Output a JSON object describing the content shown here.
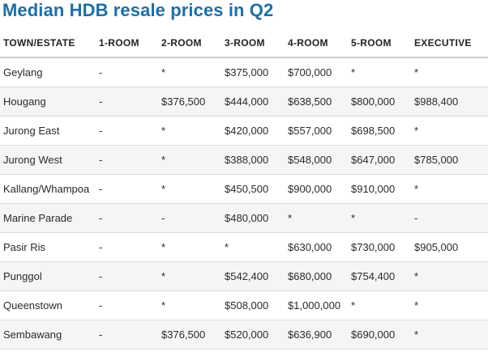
{
  "title": "Median HDB resale prices in Q2",
  "chart_data": {
    "type": "table",
    "title": "Median HDB resale prices in Q2",
    "columns": [
      "TOWN/ESTATE",
      "1-ROOM",
      "2-ROOM",
      "3-ROOM",
      "4-ROOM",
      "5-ROOM",
      "EXECUTIVE"
    ],
    "rows": [
      [
        "Geylang",
        "-",
        "*",
        "$375,000",
        "$700,000",
        "*",
        "*"
      ],
      [
        "Hougang",
        "-",
        "$376,500",
        "$444,000",
        "$638,500",
        "$800,000",
        "$988,400"
      ],
      [
        "Jurong East",
        "-",
        "*",
        "$420,000",
        "$557,000",
        "$698,500",
        "*"
      ],
      [
        "Jurong West",
        "-",
        "*",
        "$388,000",
        "$548,000",
        "$647,000",
        "$785,000"
      ],
      [
        "Kallang/Whampoa",
        "-",
        "*",
        "$450,500",
        "$900,000",
        "$910,000",
        "*"
      ],
      [
        "Marine Parade",
        "-",
        "-",
        "$480,000",
        "*",
        "*",
        "-"
      ],
      [
        "Pasir Ris",
        "-",
        "*",
        "*",
        "$630,000",
        "$730,000",
        "$905,000"
      ],
      [
        "Punggol",
        "-",
        "*",
        "$542,400",
        "$680,000",
        "$754,400",
        "*"
      ],
      [
        "Queenstown",
        "-",
        "*",
        "$508,000",
        "$1,000,000",
        "*",
        "*"
      ],
      [
        "Sembawang",
        "-",
        "$376,500",
        "$520,000",
        "$636,900",
        "$690,000",
        "*"
      ]
    ]
  }
}
